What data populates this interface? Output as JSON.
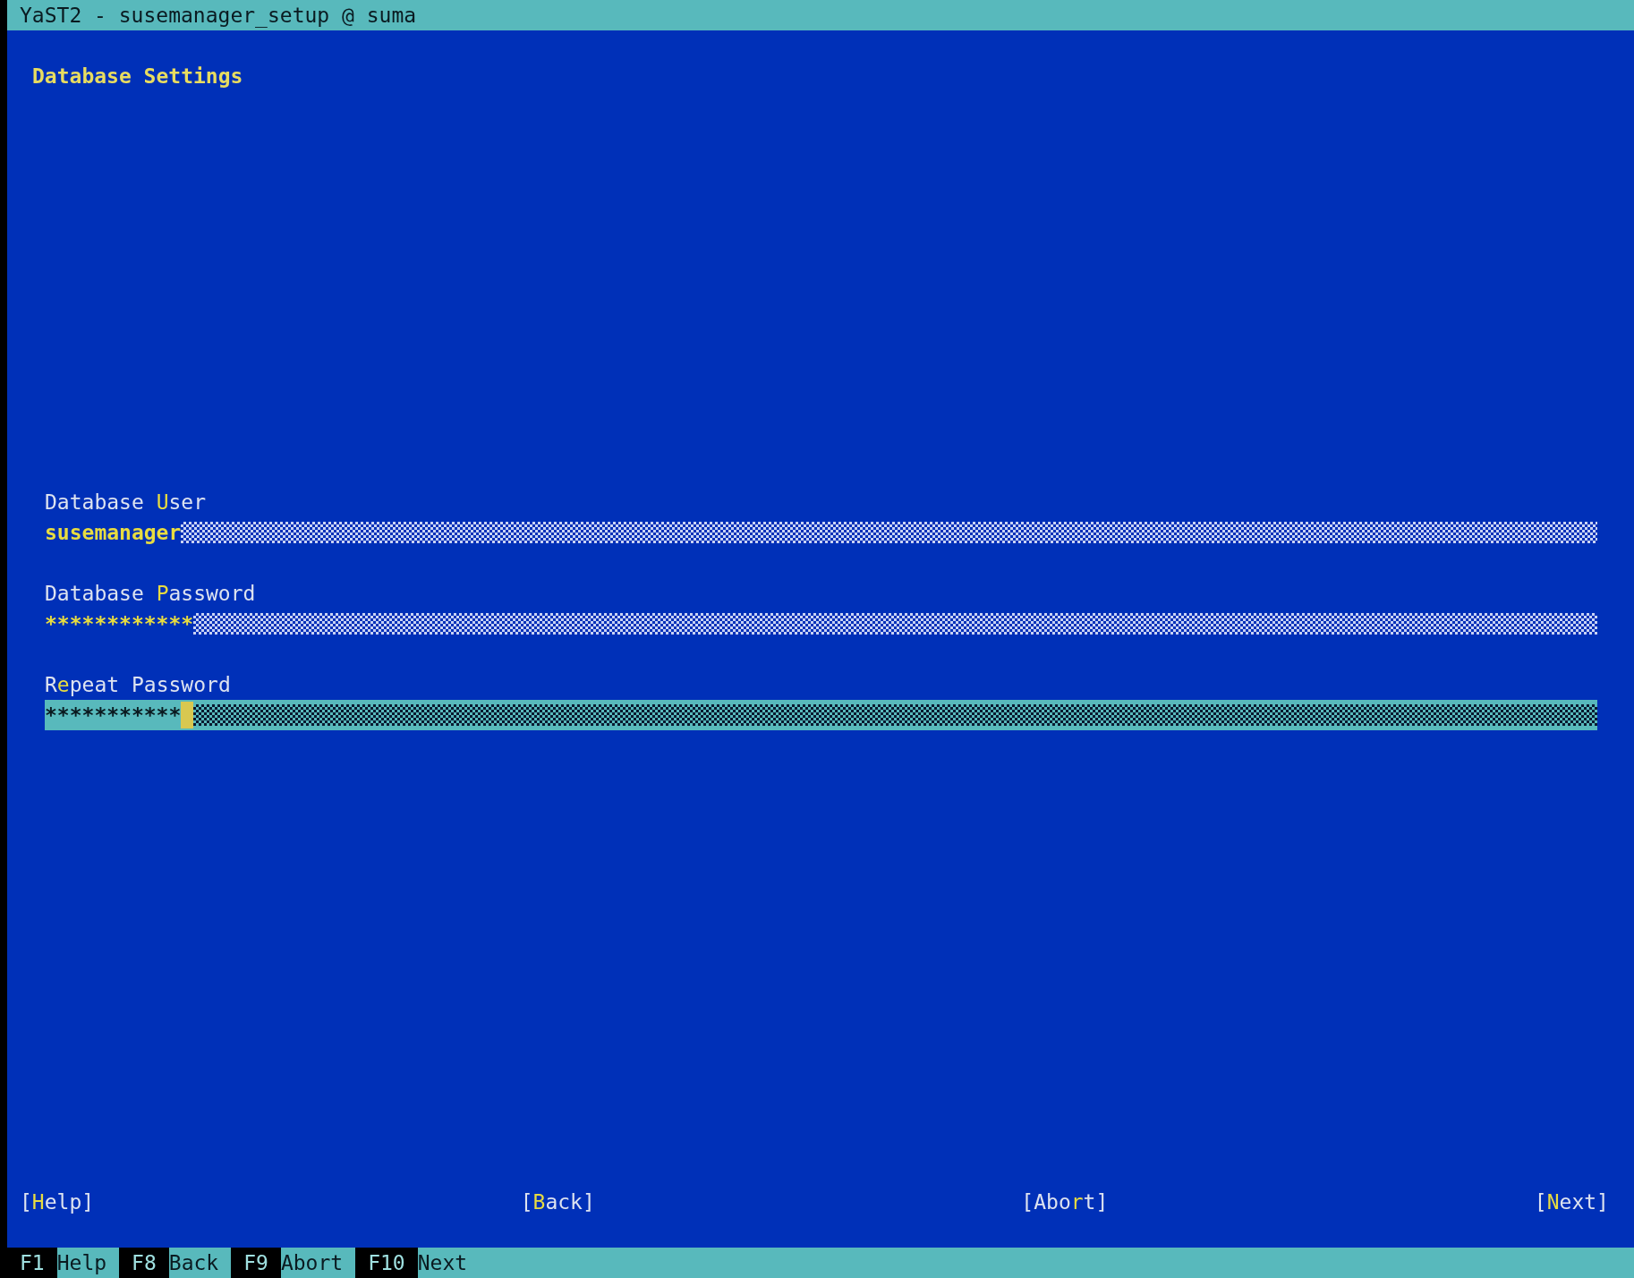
{
  "window": {
    "title": "YaST2 - susemanager_setup @ suma"
  },
  "dialog": {
    "heading": "Database Settings"
  },
  "fields": [
    {
      "label": "Database **U**ser",
      "value": "susemanager",
      "focused": false
    },
    {
      "label": "Database **P**assword",
      "value": "************",
      "focused": false
    },
    {
      "label": "R**e**peat Password",
      "value": "***********",
      "focused": true
    }
  ],
  "buttons": [
    "[**H**elp]",
    "[**B**ack]",
    "[Abo**r**t]",
    "[**N**ext]"
  ],
  "function_keys": [
    {
      "key": "F1",
      "label": "Help"
    },
    {
      "key": "F8",
      "label": "Back"
    },
    {
      "key": "F9",
      "label": "Abort"
    },
    {
      "key": "F10",
      "label": "Next"
    }
  ]
}
